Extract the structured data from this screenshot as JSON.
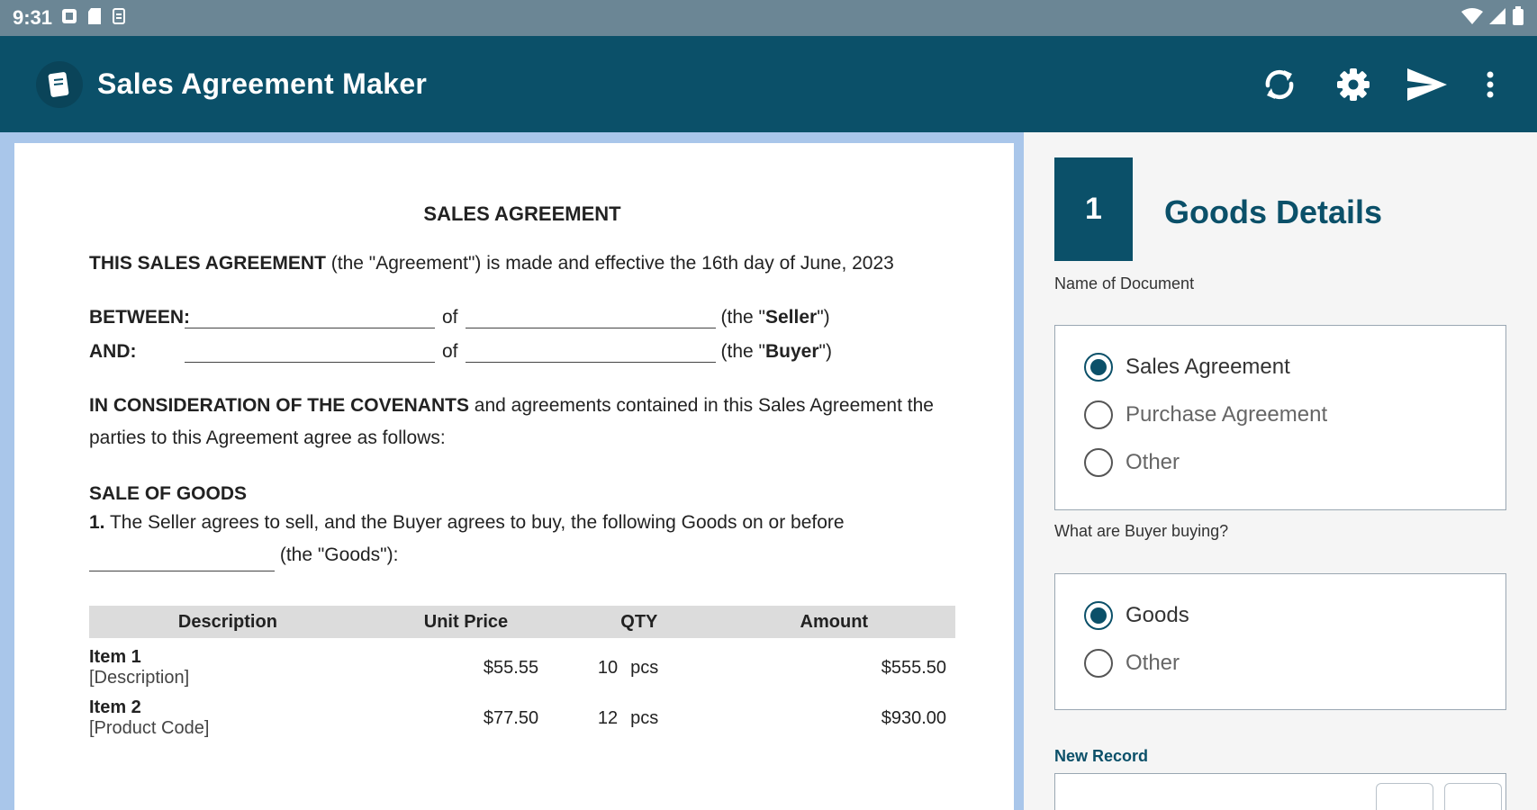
{
  "status": {
    "time": "9:31"
  },
  "app": {
    "title": "Sales Agreement Maker"
  },
  "actions": [
    "sync-icon",
    "gear-icon",
    "send-icon",
    "more-vert-icon"
  ],
  "doc": {
    "title": "SALES AGREEMENT",
    "intro_bold": "THIS SALES AGREEMENT",
    "intro_rest": " (the \"Agreement\") is made and effective the 16th day of June, 2023",
    "between_label": "BETWEEN:",
    "and_label": "AND:",
    "of": "of",
    "seller_pre": "(the \"",
    "seller_role": "Seller",
    "buyer_role": "Buyer",
    "role_post": "\")",
    "consideration_bold": "IN CONSIDERATION OF THE COVENANTS",
    "consideration_rest": " and agreements contained in this Sales Agreement the parties to this Agreement agree as follows:",
    "section_heading": "SALE OF GOODS",
    "clause_num": "1.",
    "clause_text": " The Seller agrees to sell, and the Buyer agrees to buy, the following Goods on or before",
    "goods_tail": " (the \"Goods\"):",
    "table": {
      "headers": [
        "Description",
        "Unit Price",
        "QTY",
        "Amount"
      ],
      "rows": [
        {
          "name": "Item 1",
          "desc": "[Description]",
          "price": "$55.55",
          "qty": "10",
          "unit": "pcs",
          "amount": "$555.50"
        },
        {
          "name": "Item 2",
          "desc": "[Product Code]",
          "price": "$77.50",
          "qty": "12",
          "unit": "pcs",
          "amount": "$930.00"
        }
      ]
    }
  },
  "form": {
    "step_number": "1",
    "step_title": "Goods Details",
    "name_label": "Name of Document",
    "name_options": [
      "Sales Agreement",
      "Purchase Agreement",
      "Other"
    ],
    "name_selected": "Sales Agreement",
    "buying_label": "What are Buyer buying?",
    "buying_options": [
      "Goods",
      "Other"
    ],
    "buying_selected": "Goods",
    "new_record_label": "New Record"
  },
  "colors": {
    "primary": "#0b5069",
    "status_bar": "#6b8695",
    "doc_bg": "#a9c6ea"
  }
}
